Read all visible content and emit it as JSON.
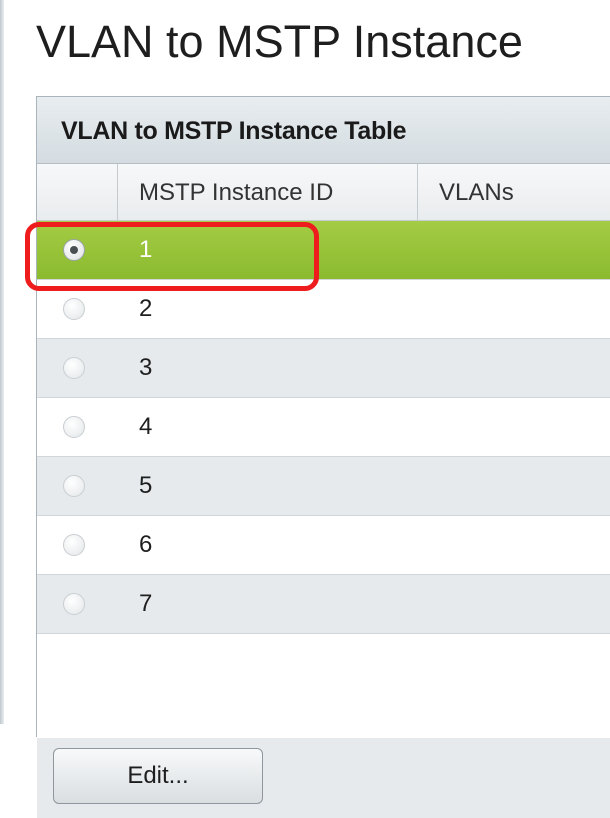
{
  "page": {
    "title": "VLAN to MSTP Instance"
  },
  "table": {
    "caption": "VLAN to MSTP Instance Table",
    "columns": [
      "MSTP Instance ID",
      "VLANs"
    ],
    "rows": [
      {
        "id": "1",
        "vlans": "",
        "selected": true
      },
      {
        "id": "2",
        "vlans": "",
        "selected": false
      },
      {
        "id": "3",
        "vlans": "",
        "selected": false
      },
      {
        "id": "4",
        "vlans": "",
        "selected": false
      },
      {
        "id": "5",
        "vlans": "",
        "selected": false
      },
      {
        "id": "6",
        "vlans": "",
        "selected": false
      },
      {
        "id": "7",
        "vlans": "",
        "selected": false
      }
    ],
    "selected_row_color": "#97c23a"
  },
  "actions": {
    "edit_label": "Edit..."
  },
  "annotation": {
    "highlight_color": "#ee1c1c"
  }
}
